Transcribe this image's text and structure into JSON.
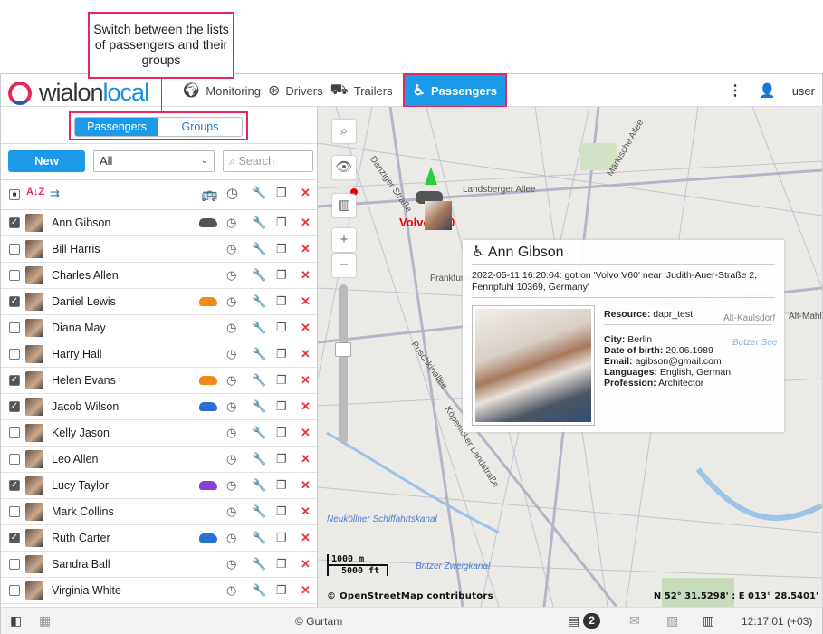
{
  "callout": {
    "text": "Switch between the lists of passengers and their groups"
  },
  "header": {
    "logo": "wialon local",
    "nav": [
      {
        "label": "Monitoring",
        "icon": "globe-icon"
      },
      {
        "label": "Drivers",
        "icon": "steering-wheel-icon"
      },
      {
        "label": "Trailers",
        "icon": "trailer-icon"
      },
      {
        "label": "Passengers",
        "icon": "passenger-seat-icon",
        "active": true
      }
    ],
    "user": "user"
  },
  "panel": {
    "tabs": [
      "Passengers",
      "Groups"
    ],
    "new_label": "New",
    "filter_value": "All",
    "search_placeholder": "Search"
  },
  "passengers": [
    {
      "name": "Ann Gibson",
      "checked": true,
      "car": "#555555"
    },
    {
      "name": "Bill Harris",
      "checked": false,
      "car": null
    },
    {
      "name": "Charles Allen",
      "checked": false,
      "car": null
    },
    {
      "name": "Daniel Lewis",
      "checked": true,
      "car": "#f08a1c"
    },
    {
      "name": "Diana May",
      "checked": false,
      "car": null
    },
    {
      "name": "Harry Hall",
      "checked": false,
      "car": null
    },
    {
      "name": "Helen Evans",
      "checked": true,
      "car": "#f08a1c"
    },
    {
      "name": "Jacob Wilson",
      "checked": true,
      "car": "#2a6fd6"
    },
    {
      "name": "Kelly Jason",
      "checked": false,
      "car": null
    },
    {
      "name": "Leo Allen",
      "checked": false,
      "car": null
    },
    {
      "name": "Lucy Taylor",
      "checked": true,
      "car": "#8a3fd0"
    },
    {
      "name": "Mark Collins",
      "checked": false,
      "car": null
    },
    {
      "name": "Ruth Carter",
      "checked": true,
      "car": "#2a6fd6"
    },
    {
      "name": "Sandra Ball",
      "checked": false,
      "car": null
    },
    {
      "name": "Virginia White",
      "checked": false,
      "car": null
    }
  ],
  "map": {
    "unit_label": "Volvo V60",
    "streets": [
      "Landsberger Allee",
      "Danziger Straße",
      "Märkische Allee",
      "Frankfurter Allee",
      "Alt-Kaulsdorf",
      "Alt-Mahlsdorf",
      "Butzer See",
      "Puschkinallee",
      "Köpenicker Landstraße",
      "Neuköllner Schiffahrtskanal",
      "Britzer Zweigkanal"
    ],
    "scale_m": "1000 m",
    "scale_ft": "5000 ft",
    "attribution": "© OpenStreetMap contributors",
    "coords": "N 52° 31.5298' : E 013° 28.5401'"
  },
  "popup": {
    "name": "Ann Gibson",
    "event": "2022-05-11 16:20:04: got on 'Volvo V60' near 'Judith-Auer-Straße 2, Fennpfuhl 10369, Germany'",
    "resource_label": "Resource:",
    "resource": "dapr_test",
    "fields": [
      {
        "k": "City:",
        "v": "Berlin"
      },
      {
        "k": "Date of birth:",
        "v": "20.06.1989"
      },
      {
        "k": "Email:",
        "v": "agibson@gmail.com"
      },
      {
        "k": "Languages:",
        "v": "English, German"
      },
      {
        "k": "Profession:",
        "v": "Architector"
      }
    ]
  },
  "footer": {
    "copyright": "© Gurtam",
    "notifications": "2",
    "time": "12:17:01 (+03)"
  }
}
